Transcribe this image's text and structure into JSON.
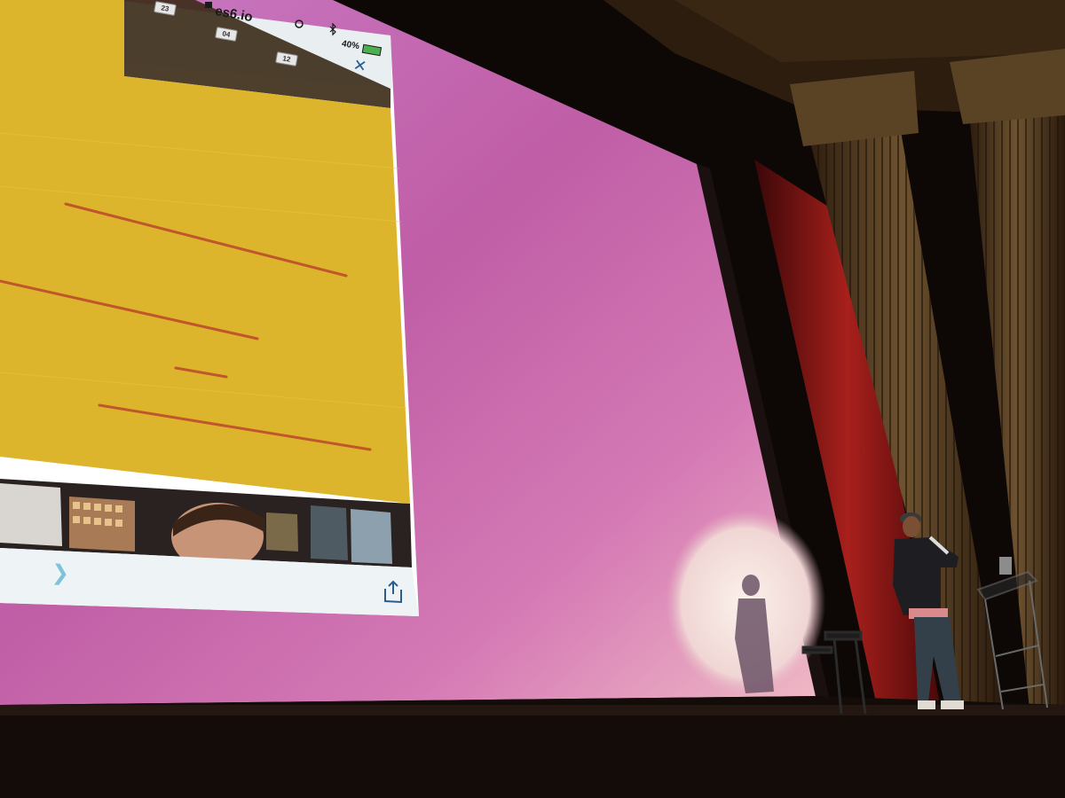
{
  "phone": {
    "url": "es6.io",
    "battery": "40%",
    "badges": [
      "23",
      "04",
      "12"
    ]
  },
  "icons": {
    "lock": "lock-icon",
    "close": "close-icon",
    "forward": "chevron-right-icon",
    "share": "share-icon",
    "moon": "moon-icon",
    "bluetooth": "bluetooth-icon",
    "battery": "battery-icon"
  },
  "colors": {
    "slide_pink": "#c872b8",
    "phone_yellow": "#dcb52c",
    "line_orange": "#c0562b",
    "curtain_red": "#9c1a1a",
    "spotlight": "#f4e6df"
  }
}
